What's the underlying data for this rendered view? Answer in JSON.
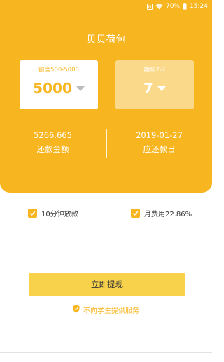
{
  "status_bar": {
    "battery": "70%",
    "time": "15:24"
  },
  "app_title": "贝贝荷包",
  "amount_card": {
    "caption": "额度500-5000",
    "value": "5000"
  },
  "term_card": {
    "caption": "期限7-7",
    "value": "7"
  },
  "summary": {
    "repay_amount_value": "5266.665",
    "repay_amount_label": "还款金额",
    "due_date_value": "2019-01-27",
    "due_date_label": "应还款日"
  },
  "options": {
    "fast_loan_label": "10分钟放款",
    "monthly_rate_label": "月费用22.86%"
  },
  "submit_label": "立即提现",
  "notice_text": "不向学生提供服务",
  "colors": {
    "accent": "#F7B520",
    "button": "#F9D24C",
    "card_light": "#FBD98A"
  }
}
